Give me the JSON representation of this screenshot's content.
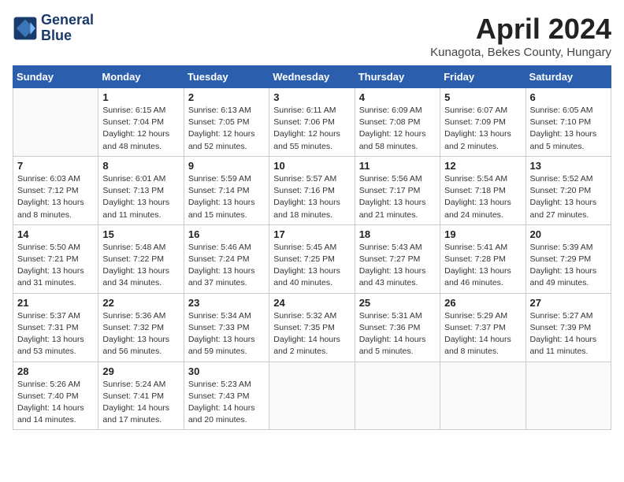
{
  "header": {
    "logo_line1": "General",
    "logo_line2": "Blue",
    "month_title": "April 2024",
    "location": "Kunagota, Bekes County, Hungary"
  },
  "days_of_week": [
    "Sunday",
    "Monday",
    "Tuesday",
    "Wednesday",
    "Thursday",
    "Friday",
    "Saturday"
  ],
  "weeks": [
    [
      {
        "num": "",
        "info": ""
      },
      {
        "num": "1",
        "info": "Sunrise: 6:15 AM\nSunset: 7:04 PM\nDaylight: 12 hours\nand 48 minutes."
      },
      {
        "num": "2",
        "info": "Sunrise: 6:13 AM\nSunset: 7:05 PM\nDaylight: 12 hours\nand 52 minutes."
      },
      {
        "num": "3",
        "info": "Sunrise: 6:11 AM\nSunset: 7:06 PM\nDaylight: 12 hours\nand 55 minutes."
      },
      {
        "num": "4",
        "info": "Sunrise: 6:09 AM\nSunset: 7:08 PM\nDaylight: 12 hours\nand 58 minutes."
      },
      {
        "num": "5",
        "info": "Sunrise: 6:07 AM\nSunset: 7:09 PM\nDaylight: 13 hours\nand 2 minutes."
      },
      {
        "num": "6",
        "info": "Sunrise: 6:05 AM\nSunset: 7:10 PM\nDaylight: 13 hours\nand 5 minutes."
      }
    ],
    [
      {
        "num": "7",
        "info": "Sunrise: 6:03 AM\nSunset: 7:12 PM\nDaylight: 13 hours\nand 8 minutes."
      },
      {
        "num": "8",
        "info": "Sunrise: 6:01 AM\nSunset: 7:13 PM\nDaylight: 13 hours\nand 11 minutes."
      },
      {
        "num": "9",
        "info": "Sunrise: 5:59 AM\nSunset: 7:14 PM\nDaylight: 13 hours\nand 15 minutes."
      },
      {
        "num": "10",
        "info": "Sunrise: 5:57 AM\nSunset: 7:16 PM\nDaylight: 13 hours\nand 18 minutes."
      },
      {
        "num": "11",
        "info": "Sunrise: 5:56 AM\nSunset: 7:17 PM\nDaylight: 13 hours\nand 21 minutes."
      },
      {
        "num": "12",
        "info": "Sunrise: 5:54 AM\nSunset: 7:18 PM\nDaylight: 13 hours\nand 24 minutes."
      },
      {
        "num": "13",
        "info": "Sunrise: 5:52 AM\nSunset: 7:20 PM\nDaylight: 13 hours\nand 27 minutes."
      }
    ],
    [
      {
        "num": "14",
        "info": "Sunrise: 5:50 AM\nSunset: 7:21 PM\nDaylight: 13 hours\nand 31 minutes."
      },
      {
        "num": "15",
        "info": "Sunrise: 5:48 AM\nSunset: 7:22 PM\nDaylight: 13 hours\nand 34 minutes."
      },
      {
        "num": "16",
        "info": "Sunrise: 5:46 AM\nSunset: 7:24 PM\nDaylight: 13 hours\nand 37 minutes."
      },
      {
        "num": "17",
        "info": "Sunrise: 5:45 AM\nSunset: 7:25 PM\nDaylight: 13 hours\nand 40 minutes."
      },
      {
        "num": "18",
        "info": "Sunrise: 5:43 AM\nSunset: 7:27 PM\nDaylight: 13 hours\nand 43 minutes."
      },
      {
        "num": "19",
        "info": "Sunrise: 5:41 AM\nSunset: 7:28 PM\nDaylight: 13 hours\nand 46 minutes."
      },
      {
        "num": "20",
        "info": "Sunrise: 5:39 AM\nSunset: 7:29 PM\nDaylight: 13 hours\nand 49 minutes."
      }
    ],
    [
      {
        "num": "21",
        "info": "Sunrise: 5:37 AM\nSunset: 7:31 PM\nDaylight: 13 hours\nand 53 minutes."
      },
      {
        "num": "22",
        "info": "Sunrise: 5:36 AM\nSunset: 7:32 PM\nDaylight: 13 hours\nand 56 minutes."
      },
      {
        "num": "23",
        "info": "Sunrise: 5:34 AM\nSunset: 7:33 PM\nDaylight: 13 hours\nand 59 minutes."
      },
      {
        "num": "24",
        "info": "Sunrise: 5:32 AM\nSunset: 7:35 PM\nDaylight: 14 hours\nand 2 minutes."
      },
      {
        "num": "25",
        "info": "Sunrise: 5:31 AM\nSunset: 7:36 PM\nDaylight: 14 hours\nand 5 minutes."
      },
      {
        "num": "26",
        "info": "Sunrise: 5:29 AM\nSunset: 7:37 PM\nDaylight: 14 hours\nand 8 minutes."
      },
      {
        "num": "27",
        "info": "Sunrise: 5:27 AM\nSunset: 7:39 PM\nDaylight: 14 hours\nand 11 minutes."
      }
    ],
    [
      {
        "num": "28",
        "info": "Sunrise: 5:26 AM\nSunset: 7:40 PM\nDaylight: 14 hours\nand 14 minutes."
      },
      {
        "num": "29",
        "info": "Sunrise: 5:24 AM\nSunset: 7:41 PM\nDaylight: 14 hours\nand 17 minutes."
      },
      {
        "num": "30",
        "info": "Sunrise: 5:23 AM\nSunset: 7:43 PM\nDaylight: 14 hours\nand 20 minutes."
      },
      {
        "num": "",
        "info": ""
      },
      {
        "num": "",
        "info": ""
      },
      {
        "num": "",
        "info": ""
      },
      {
        "num": "",
        "info": ""
      }
    ]
  ]
}
